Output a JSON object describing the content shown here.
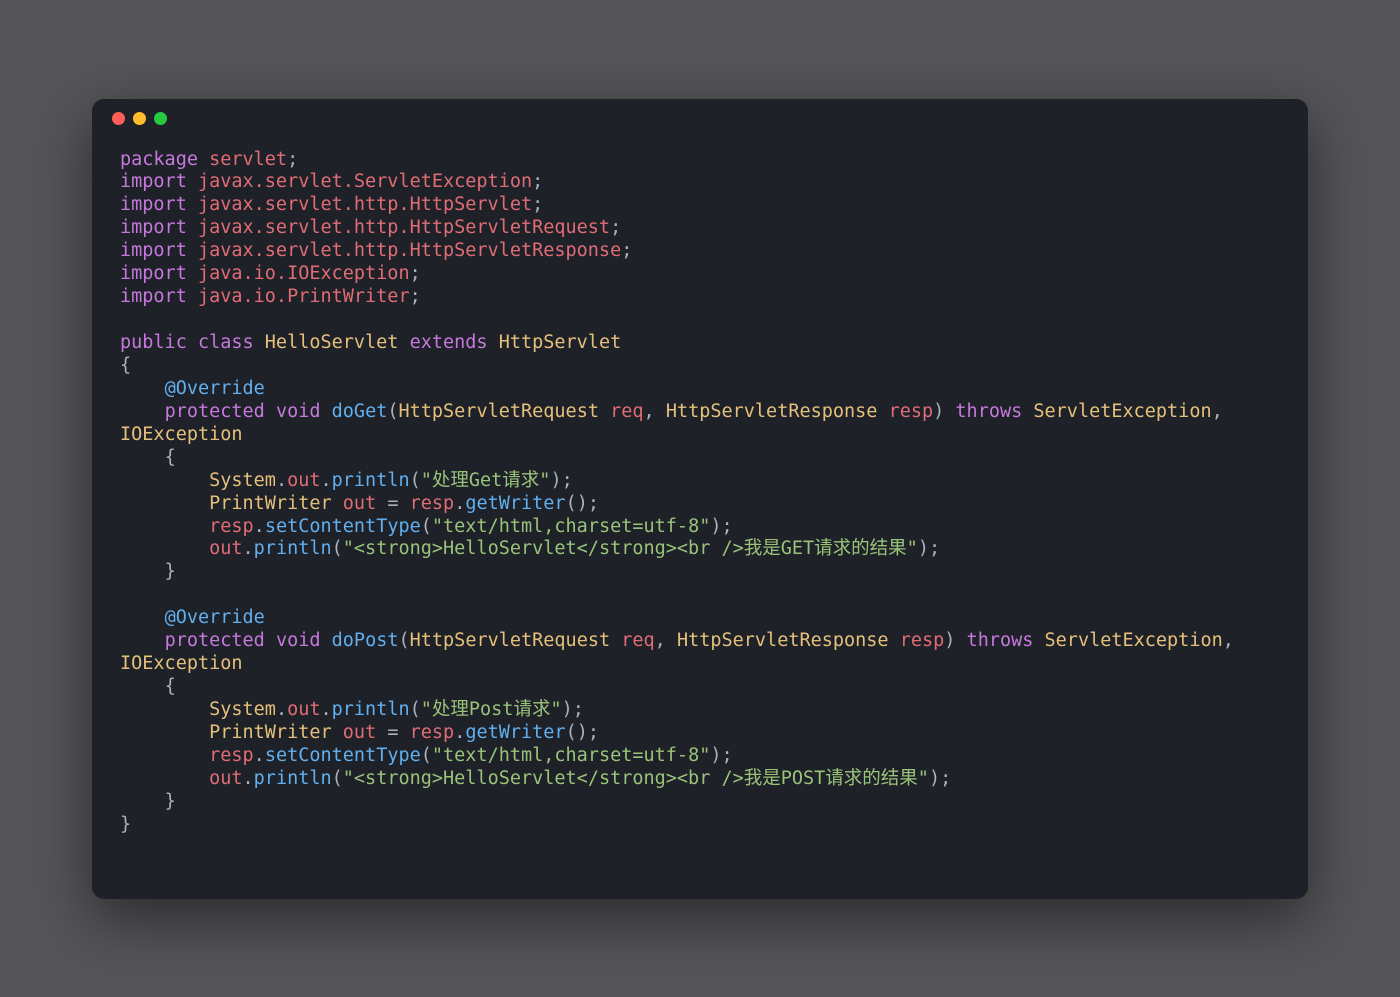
{
  "window": {
    "traffic_lights": {
      "red": "#ff5f56",
      "yellow": "#ffbd2e",
      "green": "#27c93f"
    }
  },
  "code": {
    "line1": {
      "kw": "package",
      "pkg": " servlet",
      "end": ";"
    },
    "line2": {
      "kw": "import",
      "pkg": " javax.servlet.ServletException",
      "end": ";"
    },
    "line3": {
      "kw": "import",
      "pkg": " javax.servlet.http.HttpServlet",
      "end": ";"
    },
    "line4": {
      "kw": "import",
      "pkg": " javax.servlet.http.HttpServletRequest",
      "end": ";"
    },
    "line5": {
      "kw": "import",
      "pkg": " javax.servlet.http.HttpServletResponse",
      "end": ";"
    },
    "line6": {
      "kw": "import",
      "pkg": " java.io.IOException",
      "end": ";"
    },
    "line7": {
      "kw": "import",
      "pkg": " java.io.PrintWriter",
      "end": ";"
    },
    "line9": {
      "kw1": "public",
      "kw2": " class",
      "cls": " HelloServlet",
      "kw3": " extends",
      "sup": " HttpServlet"
    },
    "line10": "{",
    "line11": {
      "indent": "    ",
      "ann": "@Override"
    },
    "line12": {
      "indent": "    ",
      "kw1": "protected",
      "kw2": " void",
      "fn": " doGet",
      "p1": "(",
      "t1": "HttpServletRequest",
      "v1": " req",
      "c1": ", ",
      "t2": "HttpServletResponse",
      "v2": " resp",
      "p2": ") ",
      "kw3": "throws",
      "t3": " ServletException",
      "c2": ",",
      "br": "\n",
      "t4": "IOException"
    },
    "line13": {
      "indent": "    ",
      "brace": "{"
    },
    "line14": {
      "indent": "        ",
      "obj": "System",
      "d1": ".",
      "fld": "out",
      "d2": ".",
      "fn": "println",
      "p1": "(",
      "str": "\"处理Get请求\"",
      "p2": ");"
    },
    "line15": {
      "indent": "        ",
      "typ": "PrintWriter",
      "var": " out",
      "eq": " = ",
      "obj": "resp",
      "d1": ".",
      "fn": "getWriter",
      "p": "();"
    },
    "line16": {
      "indent": "        ",
      "obj": "resp",
      "d1": ".",
      "fn": "setContentType",
      "p1": "(",
      "str": "\"text/html,charset=utf-8\"",
      "p2": ");"
    },
    "line17": {
      "indent": "        ",
      "obj": "out",
      "d1": ".",
      "fn": "println",
      "p1": "(",
      "str": "\"<strong>HelloServlet</strong><br />我是GET请求的结果\"",
      "p2": ");"
    },
    "line18": {
      "indent": "    ",
      "brace": "}"
    },
    "line20": {
      "indent": "    ",
      "ann": "@Override"
    },
    "line21": {
      "indent": "    ",
      "kw1": "protected",
      "kw2": " void",
      "fn": " doPost",
      "p1": "(",
      "t1": "HttpServletRequest",
      "v1": " req",
      "c1": ", ",
      "t2": "HttpServletResponse",
      "v2": " resp",
      "p2": ") ",
      "kw3": "throws",
      "t3": " ServletException",
      "c2": ",",
      "br": "\n",
      "t4": "IOException"
    },
    "line22": {
      "indent": "    ",
      "brace": "{"
    },
    "line23": {
      "indent": "        ",
      "obj": "System",
      "d1": ".",
      "fld": "out",
      "d2": ".",
      "fn": "println",
      "p1": "(",
      "str": "\"处理Post请求\"",
      "p2": ");"
    },
    "line24": {
      "indent": "        ",
      "typ": "PrintWriter",
      "var": " out",
      "eq": " = ",
      "obj": "resp",
      "d1": ".",
      "fn": "getWriter",
      "p": "();"
    },
    "line25": {
      "indent": "        ",
      "obj": "resp",
      "d1": ".",
      "fn": "setContentType",
      "p1": "(",
      "str": "\"text/html,charset=utf-8\"",
      "p2": ");"
    },
    "line26": {
      "indent": "        ",
      "obj": "out",
      "d1": ".",
      "fn": "println",
      "p1": "(",
      "str": "\"<strong>HelloServlet</strong><br />我是POST请求的结果\"",
      "p2": ");"
    },
    "line27": {
      "indent": "    ",
      "brace": "}"
    },
    "line28": "}"
  }
}
